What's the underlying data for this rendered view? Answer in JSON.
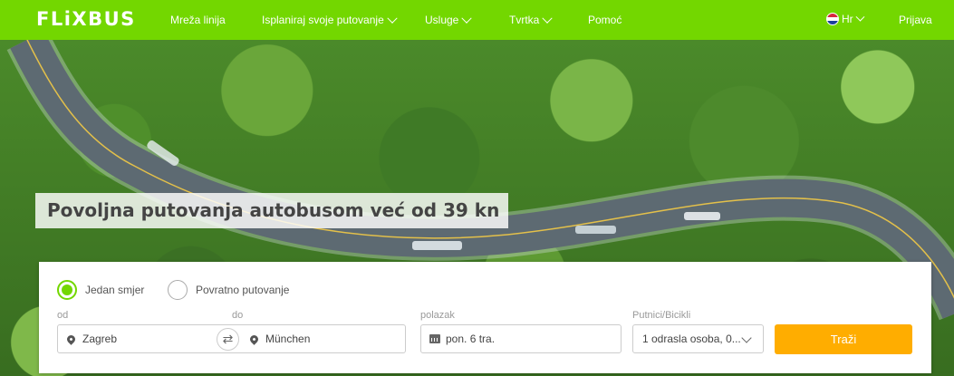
{
  "nav": {
    "logo": "FLiXBUS",
    "items": [
      {
        "label": "Mreža linija",
        "dropdown": false
      },
      {
        "label": "Isplaniraj svoje putovanje",
        "dropdown": true
      },
      {
        "label": "Usluge",
        "dropdown": true
      },
      {
        "label": "Tvrtka",
        "dropdown": true
      },
      {
        "label": "Pomoć",
        "dropdown": false
      }
    ],
    "language": "Hr",
    "login": "Prijava",
    "brand_color": "#73d700"
  },
  "hero": {
    "headline": "Povoljna putovanja autobusom već od 39 kn"
  },
  "search": {
    "trip_types": [
      {
        "label": "Jedan smjer",
        "selected": true
      },
      {
        "label": "Povratno putovanje",
        "selected": false
      }
    ],
    "from_label": "od",
    "to_label": "do",
    "from_value": "Zagreb",
    "to_value": "München",
    "departure_label": "polazak",
    "departure_value": "pon. 6 tra.",
    "passengers_label": "Putnici/Bicikli",
    "passengers_value": "1 odrasla osoba, 0...",
    "search_button": "Traži",
    "button_color": "#ffad00"
  }
}
